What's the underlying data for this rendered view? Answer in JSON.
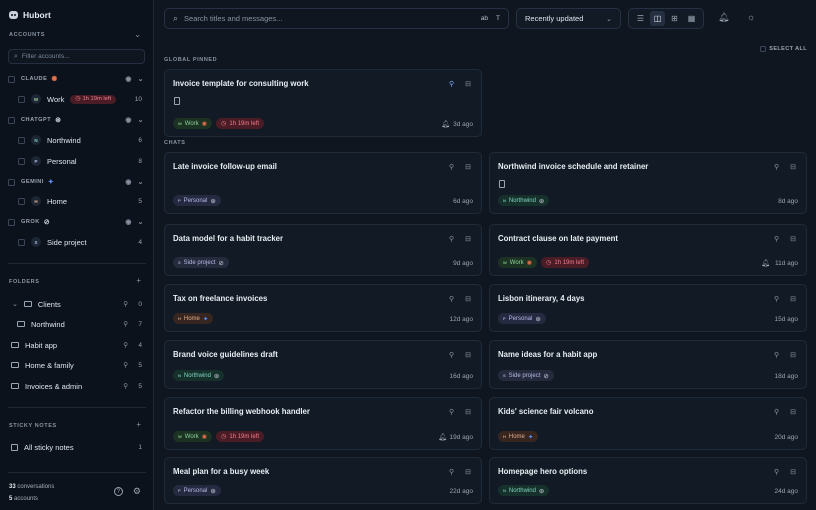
{
  "app": {
    "name": "Hubort"
  },
  "sidebar": {
    "accounts_label": "ACCOUNTS",
    "filter_placeholder": "Filter accounts...",
    "providers": [
      {
        "name": "CLAUDE",
        "glyph": "✺",
        "glyph_color": "#e2704c"
      },
      {
        "name": "CHATGPT",
        "glyph": "⊛",
        "glyph_color": "#c9d1db"
      },
      {
        "name": "GEMINI",
        "glyph": "✦",
        "glyph_color": "#5b8cf5"
      },
      {
        "name": "GROK",
        "glyph": "⊘",
        "glyph_color": "#c9d1db"
      }
    ],
    "accounts": [
      {
        "initial": "W",
        "name": "Work",
        "count": "10",
        "timer": "1h 19m left"
      },
      {
        "initial": "N",
        "name": "Northwind",
        "count": "6"
      },
      {
        "initial": "P",
        "name": "Personal",
        "count": "8"
      },
      {
        "initial": "H",
        "name": "Home",
        "count": "5"
      },
      {
        "initial": "S",
        "name": "Side project",
        "count": "4"
      }
    ],
    "folders_label": "FOLDERS",
    "folders": [
      {
        "name": "Clients",
        "count": "0"
      },
      {
        "name": "Northwind",
        "count": "7"
      },
      {
        "name": "Habit app",
        "count": "4"
      },
      {
        "name": "Home & family",
        "count": "5"
      },
      {
        "name": "Invoices & admin",
        "count": "5"
      }
    ],
    "sticky_label": "STICKY NOTES",
    "sticky": {
      "name": "All sticky notes",
      "count": "1"
    },
    "footer": {
      "conversations_count": "33",
      "conversations_label": "conversations",
      "accounts_count": "5",
      "accounts_label": "accounts"
    }
  },
  "topbar": {
    "search_placeholder": "Search titles and messages...",
    "opt_ab": "ab",
    "opt_t": "T",
    "sort_value": "Recently updated",
    "select_all": "SELECT ALL"
  },
  "sections": {
    "pinned": "GLOBAL PINNED",
    "chats": "CHATS"
  },
  "pinned_card": {
    "title": "Invoice template for consulting work",
    "chip": "Work",
    "chip_initial": "W",
    "chip_glyph": "✺",
    "timer": "1h 19m left",
    "date": "3d ago"
  },
  "chats": [
    {
      "title": "Late invoice follow-up email",
      "chip": "Personal",
      "chip_initial": "P",
      "chip_glyph": "⊛",
      "date": "6d ago"
    },
    {
      "title": "Northwind invoice schedule and retainer",
      "chip": "Northwind",
      "chip_initial": "N",
      "chip_glyph": "⊛",
      "date": "8d ago"
    },
    {
      "title": "Data model for a habit tracker",
      "chip": "Side project",
      "chip_initial": "S",
      "chip_glyph": "⊘",
      "date": "9d ago"
    },
    {
      "title": "Contract clause on late payment",
      "chip": "Work",
      "chip_initial": "W",
      "chip_glyph": "✺",
      "timer": "1h 19m left",
      "date": "11d ago"
    },
    {
      "title": "Tax on freelance invoices",
      "chip": "Home",
      "chip_initial": "H",
      "chip_glyph": "✦",
      "date": "12d ago"
    },
    {
      "title": "Lisbon itinerary, 4 days",
      "chip": "Personal",
      "chip_initial": "P",
      "chip_glyph": "⊛",
      "date": "15d ago"
    },
    {
      "title": "Brand voice guidelines draft",
      "chip": "Northwind",
      "chip_initial": "N",
      "chip_glyph": "⊛",
      "date": "16d ago"
    },
    {
      "title": "Name ideas for a habit app",
      "chip": "Side project",
      "chip_initial": "S",
      "chip_glyph": "⊘",
      "date": "18d ago"
    },
    {
      "title": "Refactor the billing webhook handler",
      "chip": "Work",
      "chip_initial": "W",
      "chip_glyph": "✺",
      "timer": "1h 19m left",
      "date": "19d ago"
    },
    {
      "title": "Kids' science fair volcano",
      "chip": "Home",
      "chip_initial": "H",
      "chip_glyph": "✦",
      "date": "20d ago"
    },
    {
      "title": "Meal plan for a busy week",
      "chip": "Personal",
      "chip_initial": "P",
      "chip_glyph": "⊛",
      "date": "22d ago"
    },
    {
      "title": "Homepage hero options",
      "chip": "Northwind",
      "chip_initial": "N",
      "chip_glyph": "⊛",
      "date": "24d ago"
    }
  ],
  "icons": {
    "pin": "pin-icon",
    "archive": "archive-icon",
    "bell": "bell-icon",
    "document": "document-icon",
    "eye": "eye-icon",
    "search": "search-icon",
    "settings": "gear-icon",
    "help": "help-icon",
    "theme": "sun-icon",
    "list_view": "list-view-icon",
    "split_view": "split-view-icon",
    "grid_view": "grid-view-icon",
    "dense_grid_view": "dense-grid-icon"
  }
}
